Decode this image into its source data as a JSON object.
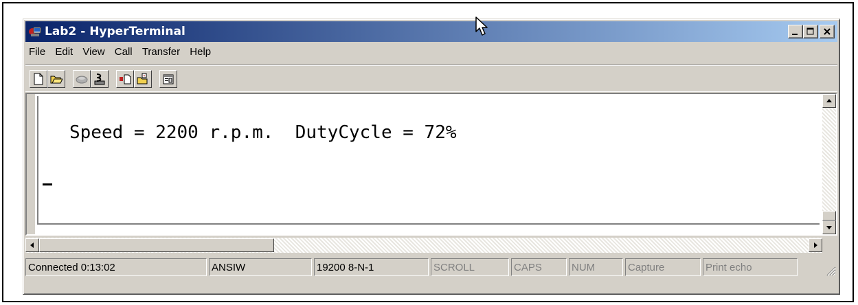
{
  "window": {
    "title": "Lab2 - HyperTerminal"
  },
  "menu": [
    "File",
    "Edit",
    "View",
    "Call",
    "Transfer",
    "Help"
  ],
  "toolbar": {
    "icons": [
      "new-icon",
      "open-icon",
      "connect-icon",
      "disconnect-icon",
      "send-icon",
      "receive-icon",
      "properties-icon"
    ]
  },
  "terminal": {
    "line": "Speed = 2200 r.p.m.  DutyCycle = 72%"
  },
  "status": {
    "connected": "Connected 0:13:02",
    "emulation": "ANSIW",
    "settings": "19200 8-N-1",
    "scroll": "SCROLL",
    "caps": "CAPS",
    "num": "NUM",
    "capture": "Capture",
    "print_echo": "Print echo"
  },
  "colors": {
    "title_start": "#0a246a",
    "title_end": "#a6caf0",
    "face": "#d4d0c8"
  }
}
